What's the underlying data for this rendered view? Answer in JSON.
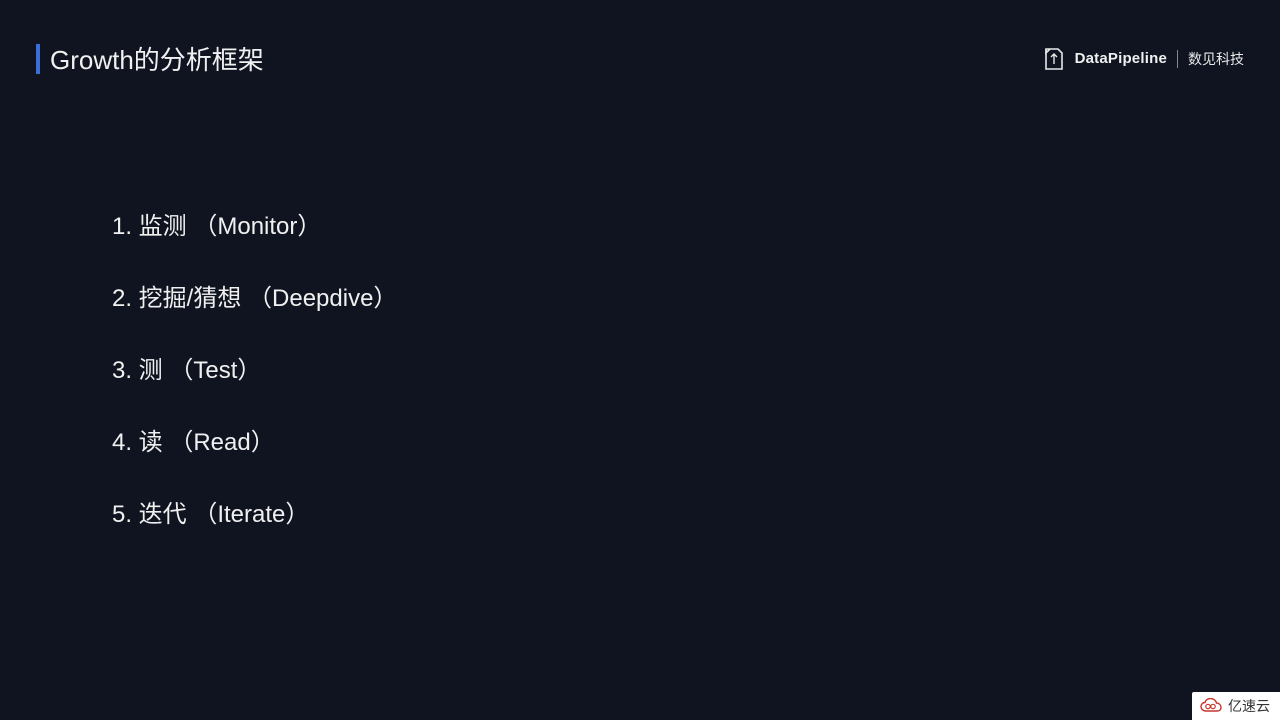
{
  "header": {
    "title": "Growth的分析框架",
    "logo_brand": "DataPipeline",
    "logo_cn": "数见科技"
  },
  "list": [
    "1. 监测 （Monitor）",
    "2. 挖掘/猜想 （Deepdive）",
    "3. 测 （Test）",
    "4. 读 （Read）",
    "5. 迭代 （Iterate）"
  ],
  "watermark": "亿速云"
}
